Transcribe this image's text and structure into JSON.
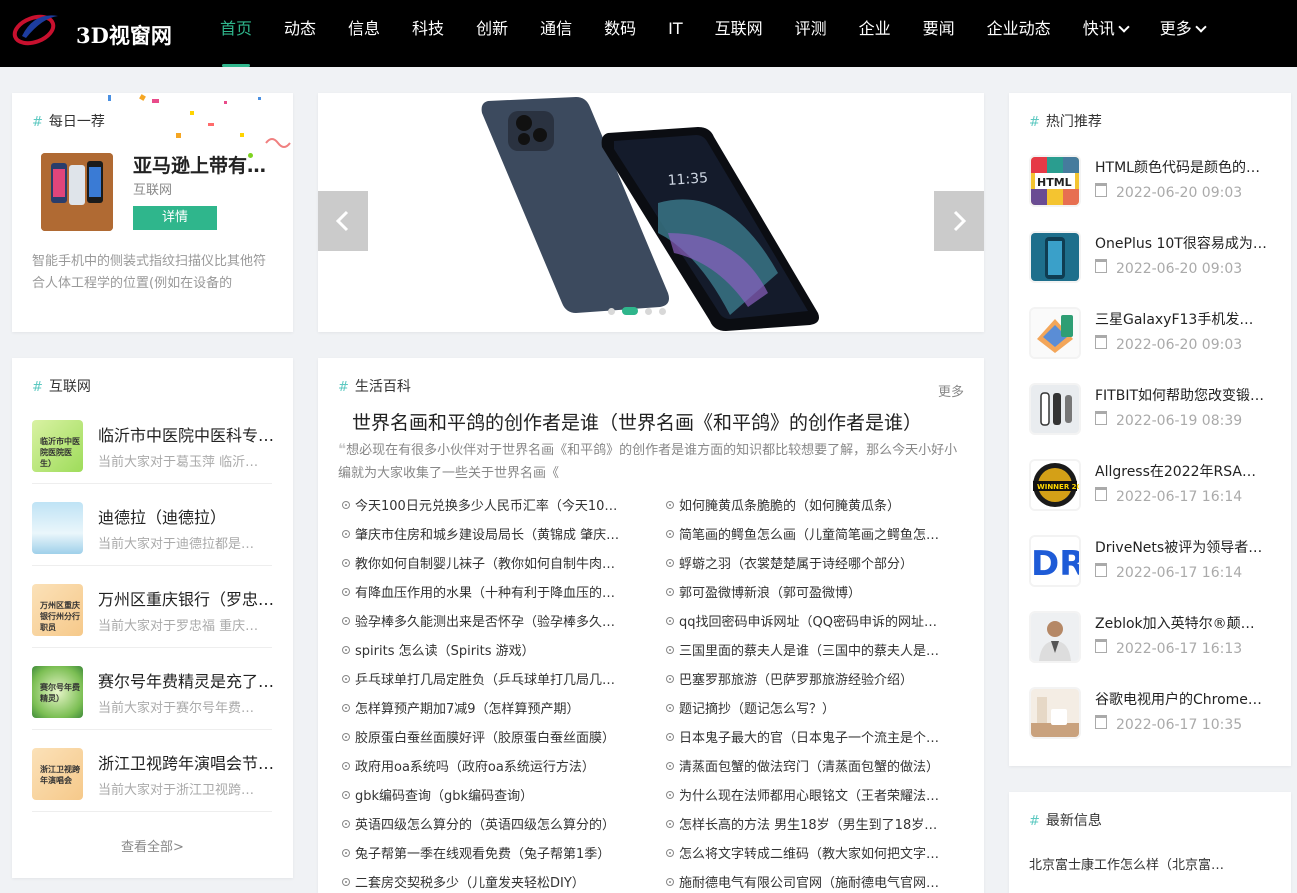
{
  "brand": {
    "logo_text": "3D视窗网",
    "accent": "#2fb68c"
  },
  "nav": {
    "items": [
      "首页",
      "动态",
      "信息",
      "科技",
      "创新",
      "通信",
      "数码",
      "IT",
      "互联网",
      "评测",
      "企业",
      "要闻",
      "企业动态"
    ],
    "dropdowns": [
      "快讯",
      "更多"
    ],
    "active": "首页"
  },
  "daily": {
    "title": "每日一荐",
    "item_title": "亚马逊上带有…",
    "category": "互联网",
    "button": "详情",
    "desc": "智能手机中的侧装式指纹扫描仪比其他符合人体工程学的位置(例如在设备的"
  },
  "slider": {
    "dot_count": 4,
    "active_dot": 1
  },
  "internet": {
    "title": "互联网",
    "items": [
      {
        "thumb_text": "临沂市中医院医院医生）",
        "title": "临沂市中医院中医科专…",
        "desc": "当前大家对于葛玉萍 临沂…"
      },
      {
        "thumb_text": "",
        "title": "迪德拉（迪德拉）",
        "desc": "当前大家对于迪德拉都是…"
      },
      {
        "thumb_text": "万州区重庆银行州分行职员",
        "title": "万州区重庆银行（罗忠…",
        "desc": "当前大家对于罗忠福 重庆…"
      },
      {
        "thumb_text": "赛尔号年费精灵）",
        "title": "赛尔号年费精灵是充了…",
        "desc": "当前大家对于赛尔号年费…"
      },
      {
        "thumb_text": "浙江卫视跨年演唱会",
        "title": "浙江卫视跨年演唱会节…",
        "desc": "当前大家对于浙江卫视跨…"
      }
    ],
    "view_all": "查看全部>"
  },
  "life": {
    "title": "生活百科",
    "more": "更多",
    "headline": "世界名画和平鸽的创作者是谁（世界名画《和平鸽》的创作者是谁）",
    "intro": "想必现在有很多小伙伴对于世界名画《和平鸽》的创作者是谁方面的知识都比较想要了解，那么今天小好小编就为大家收集了一些关于世界名画《",
    "left": [
      "今天100日元兑换多少人民币汇率（今天10…",
      "肇庆市住房和城乡建设局局长（黄锦成 肇庆…",
      "教你如何自制婴儿袜子（教你如何自制牛肉…",
      "有降血压作用的水果（十种有利于降血压的…",
      "验孕棒多久能测出来是否怀孕（验孕棒多久…",
      "spirits 怎么读（Spirits 游戏）",
      "乒乓球单打几局定胜负（乒乓球单打几局几…",
      "怎样算预产期加7减9（怎样算预产期）",
      "胶原蛋白蚕丝面膜好评（胶原蛋白蚕丝面膜）",
      "政府用oa系统吗（政府oa系统运行方法）",
      "gbk编码查询（gbk编码查询）",
      "英语四级怎么算分的（英语四级怎么算分的）",
      "兔子帮第一季在线观看免费（兔子帮第1季）",
      "二套房交契税多少（儿童发夹轻松DIY）"
    ],
    "right": [
      "如何腌黄瓜条脆脆的（如何腌黄瓜条）",
      "简笔画的鳄鱼怎么画（儿童简笔画之鳄鱼怎…",
      "蜉蝣之羽（衣裳楚楚属于诗经哪个部分）",
      "郭可盈微博新浪（郭可盈微博）",
      "qq找回密码申诉网址（QQ密码申诉的网址…",
      "三国里面的蔡夫人是谁（三国中的蔡夫人是…",
      "巴塞罗那旅游（巴萨罗那旅游经验介绍）",
      "题记摘抄（题记怎么写？）",
      "日本鬼子最大的官（日本鬼子一个流主是个…",
      "清蒸面包蟹的做法窍门（清蒸面包蟹的做法）",
      "为什么现在法师都用心眼铭文（王者荣耀法…",
      "怎样长高的方法 男生18岁（男生到了18岁…",
      "怎么将文字转成二维码（教大家如何把文字…",
      "施耐德电气有限公司官网（施耐德电气官网…"
    ]
  },
  "hot": {
    "title": "热门推荐",
    "items": [
      {
        "title": "HTML颜色代码是颜色的…",
        "date": "2022-06-20 09:03",
        "thumb": "HTML"
      },
      {
        "title": "OnePlus 10T很容易成为…",
        "date": "2022-06-20 09:03",
        "thumb": ""
      },
      {
        "title": "三星GalaxyF13手机发布…",
        "date": "2022-06-20 09:03",
        "thumb": ""
      },
      {
        "title": "FITBIT如何帮助您改变锻…",
        "date": "2022-06-19 08:39",
        "thumb": ""
      },
      {
        "title": "Allgress在2022年RSA大…",
        "date": "2022-06-17 16:14",
        "thumb": "WINNER 2022"
      },
      {
        "title": "DriveNets被评为领导者…",
        "date": "2022-06-17 16:14",
        "thumb": "DR"
      },
      {
        "title": "Zeblok加入英特尔®颠覆…",
        "date": "2022-06-17 16:13",
        "thumb": ""
      },
      {
        "title": "谷歌电视用户的Chromec…",
        "date": "2022-06-17 10:35",
        "thumb": ""
      }
    ]
  },
  "latest": {
    "title": "最新信息",
    "items": [
      "北京富士康工作怎么样（北京富…"
    ]
  }
}
